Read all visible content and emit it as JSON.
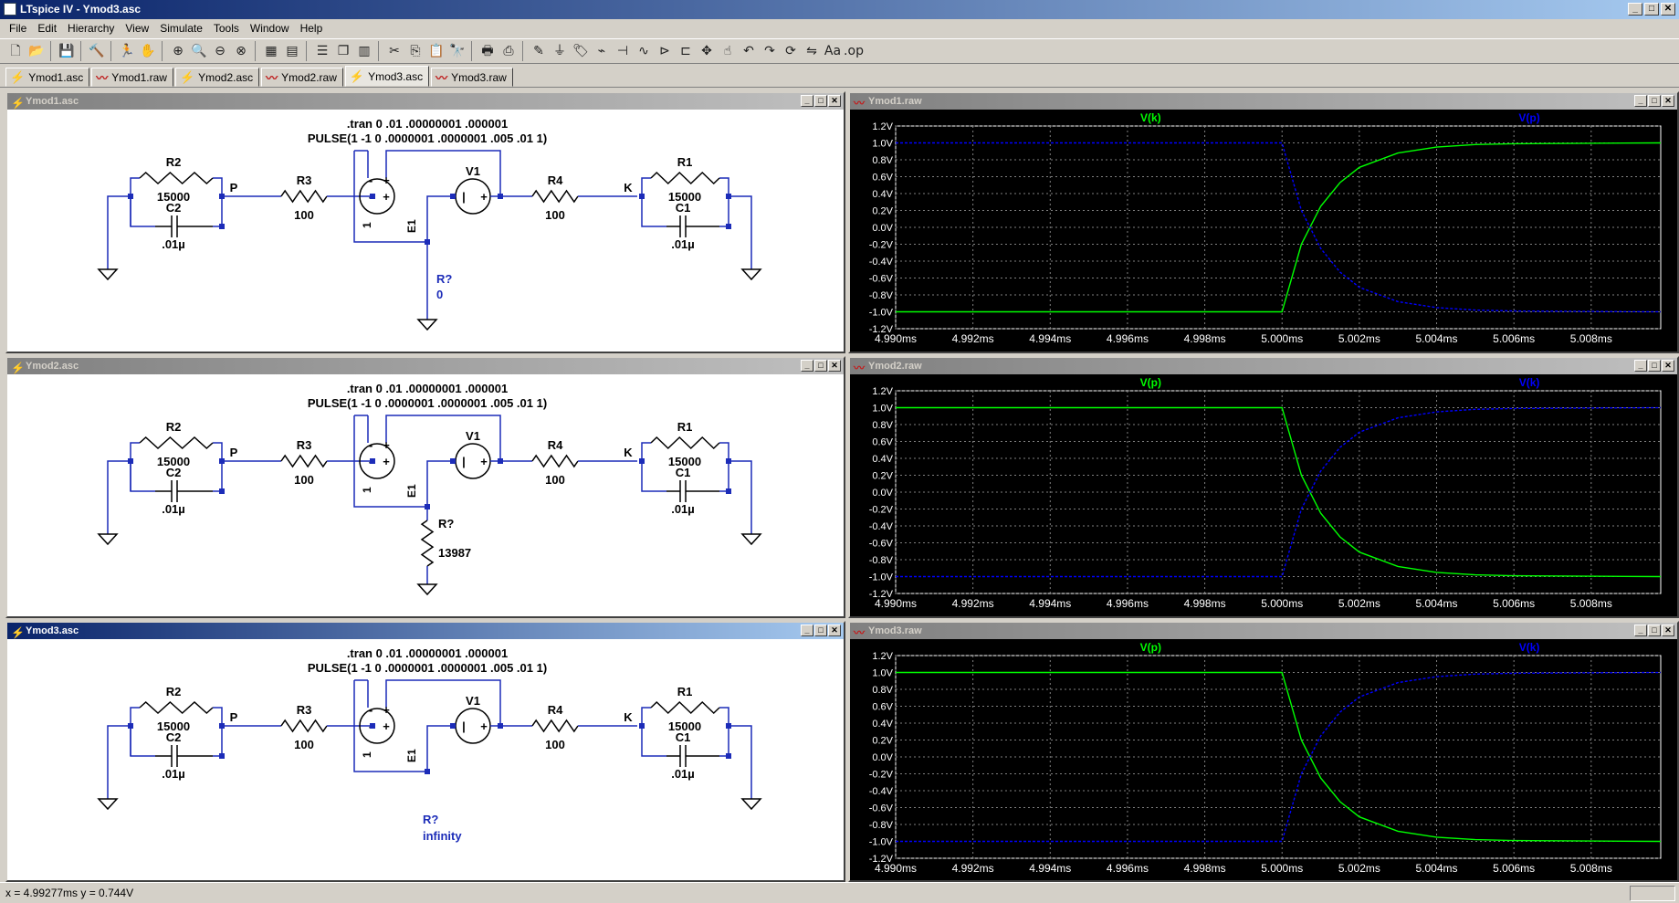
{
  "window": {
    "title": "LTspice IV - Ymod3.asc",
    "min": "_",
    "max": "□",
    "close": "✕"
  },
  "menu": [
    "File",
    "Edit",
    "Hierarchy",
    "View",
    "Simulate",
    "Tools",
    "Window",
    "Help"
  ],
  "tabs": [
    {
      "label": "Ymod1.asc",
      "icon": "schematic-icon"
    },
    {
      "label": "Ymod1.raw",
      "icon": "waveform-icon"
    },
    {
      "label": "Ymod2.asc",
      "icon": "schematic-icon"
    },
    {
      "label": "Ymod2.raw",
      "icon": "waveform-icon"
    },
    {
      "label": "Ymod3.asc",
      "icon": "schematic-icon",
      "active": true
    },
    {
      "label": "Ymod3.raw",
      "icon": "waveform-icon"
    }
  ],
  "schematics": [
    {
      "title": "Ymod1.asc",
      "active": false,
      "directive1": ".tran 0 .01 .00000001 .000001",
      "directive2": "PULSE(1 -1 0 .0000001 .0000001 .005 .01 1)",
      "r2": "R2",
      "r2val": "15000",
      "c2": "C2",
      "c2val": ".01µ",
      "node_p": "P",
      "r3": "R3",
      "r3val": "100",
      "e1": "E1",
      "e1gain": "1",
      "v1": "V1",
      "r4": "R4",
      "r4val": "100",
      "node_k": "K",
      "r1": "R1",
      "r1val": "15000",
      "c1": "C1",
      "c1val": ".01µ",
      "rq": "R?",
      "rqval": "0",
      "rq_kind": "short"
    },
    {
      "title": "Ymod2.asc",
      "active": false,
      "directive1": ".tran 0 .01 .00000001 .000001",
      "directive2": "PULSE(1 -1 0 .0000001 .0000001 .005 .01 1)",
      "r2": "R2",
      "r2val": "15000",
      "c2": "C2",
      "c2val": ".01µ",
      "node_p": "P",
      "r3": "R3",
      "r3val": "100",
      "e1": "E1",
      "e1gain": "1",
      "v1": "V1",
      "r4": "R4",
      "r4val": "100",
      "node_k": "K",
      "r1": "R1",
      "r1val": "15000",
      "c1": "C1",
      "c1val": ".01µ",
      "rq": "R?",
      "rqval": "13987",
      "rq_kind": "resistor"
    },
    {
      "title": "Ymod3.asc",
      "active": true,
      "directive1": ".tran 0 .01 .00000001 .000001",
      "directive2": "PULSE(1 -1 0 .0000001 .0000001 .005 .01 1)",
      "r2": "R2",
      "r2val": "15000",
      "c2": "C2",
      "c2val": ".01µ",
      "node_p": "P",
      "r3": "R3",
      "r3val": "100",
      "e1": "E1",
      "e1gain": "1",
      "v1": "V1",
      "r4": "R4",
      "r4val": "100",
      "node_k": "K",
      "r1": "R1",
      "r1val": "15000",
      "c1": "C1",
      "c1val": ".01µ",
      "rq": "R?",
      "rqval": "infinity",
      "rq_kind": "open"
    }
  ],
  "chart_data": [
    {
      "type": "line",
      "title": "Ymod1.raw",
      "xlim": [
        4.99,
        5.0098
      ],
      "ylim": [
        -1.2,
        1.2
      ],
      "xticks": [
        "4.990ms",
        "4.992ms",
        "4.994ms",
        "4.996ms",
        "4.998ms",
        "5.000ms",
        "5.002ms",
        "5.004ms",
        "5.006ms",
        "5.008ms"
      ],
      "xtick_values": [
        4.99,
        4.992,
        4.994,
        4.996,
        4.998,
        5.0,
        5.002,
        5.004,
        5.006,
        5.008
      ],
      "yticks": [
        "1.2V",
        "1.0V",
        "0.8V",
        "0.6V",
        "0.4V",
        "0.2V",
        "0.0V",
        "-0.2V",
        "-0.4V",
        "-0.6V",
        "-0.8V",
        "-1.0V",
        "-1.2V"
      ],
      "ytick_values": [
        1.2,
        1.0,
        0.8,
        0.6,
        0.4,
        0.2,
        0.0,
        -0.2,
        -0.4,
        -0.6,
        -0.8,
        -1.0,
        -1.2
      ],
      "grid": true,
      "series": [
        {
          "name": "V(k)",
          "color": "#00ff00",
          "x": [
            4.99,
            5.0,
            5.0005,
            5.001,
            5.0015,
            5.002,
            5.003,
            5.004,
            5.005,
            5.006,
            5.0098
          ],
          "y": [
            -1.0,
            -1.0,
            -0.2,
            0.25,
            0.53,
            0.71,
            0.88,
            0.95,
            0.98,
            0.99,
            1.0
          ]
        },
        {
          "name": "V(p)",
          "color": "#0000ff",
          "x": [
            4.99,
            5.0,
            5.0005,
            5.001,
            5.0015,
            5.002,
            5.003,
            5.004,
            5.005,
            5.006,
            5.0098
          ],
          "y": [
            1.0,
            1.0,
            0.2,
            -0.25,
            -0.53,
            -0.71,
            -0.88,
            -0.95,
            -0.98,
            -0.99,
            -1.0
          ]
        }
      ]
    },
    {
      "type": "line",
      "title": "Ymod2.raw",
      "xlim": [
        4.99,
        5.0098
      ],
      "ylim": [
        -1.2,
        1.2
      ],
      "xticks": [
        "4.990ms",
        "4.992ms",
        "4.994ms",
        "4.996ms",
        "4.998ms",
        "5.000ms",
        "5.002ms",
        "5.004ms",
        "5.006ms",
        "5.008ms"
      ],
      "xtick_values": [
        4.99,
        4.992,
        4.994,
        4.996,
        4.998,
        5.0,
        5.002,
        5.004,
        5.006,
        5.008
      ],
      "yticks": [
        "1.2V",
        "1.0V",
        "0.8V",
        "0.6V",
        "0.4V",
        "0.2V",
        "0.0V",
        "-0.2V",
        "-0.4V",
        "-0.6V",
        "-0.8V",
        "-1.0V",
        "-1.2V"
      ],
      "ytick_values": [
        1.2,
        1.0,
        0.8,
        0.6,
        0.4,
        0.2,
        0.0,
        -0.2,
        -0.4,
        -0.6,
        -0.8,
        -1.0,
        -1.2
      ],
      "grid": true,
      "series": [
        {
          "name": "V(p)",
          "color": "#00ff00",
          "x": [
            4.99,
            5.0,
            5.0005,
            5.001,
            5.0015,
            5.002,
            5.003,
            5.004,
            5.005,
            5.006,
            5.0098
          ],
          "y": [
            1.0,
            1.0,
            0.2,
            -0.25,
            -0.53,
            -0.71,
            -0.88,
            -0.95,
            -0.98,
            -0.99,
            -1.0
          ]
        },
        {
          "name": "V(k)",
          "color": "#0000ff",
          "x": [
            4.99,
            5.0,
            5.0005,
            5.001,
            5.0015,
            5.002,
            5.003,
            5.004,
            5.005,
            5.006,
            5.0098
          ],
          "y": [
            -1.0,
            -1.0,
            -0.2,
            0.25,
            0.53,
            0.71,
            0.88,
            0.95,
            0.98,
            0.99,
            1.0
          ]
        }
      ]
    },
    {
      "type": "line",
      "title": "Ymod3.raw",
      "xlim": [
        4.99,
        5.0098
      ],
      "ylim": [
        -1.2,
        1.2
      ],
      "xticks": [
        "4.990ms",
        "4.992ms",
        "4.994ms",
        "4.996ms",
        "4.998ms",
        "5.000ms",
        "5.002ms",
        "5.004ms",
        "5.006ms",
        "5.008ms"
      ],
      "xtick_values": [
        4.99,
        4.992,
        4.994,
        4.996,
        4.998,
        5.0,
        5.002,
        5.004,
        5.006,
        5.008
      ],
      "yticks": [
        "1.2V",
        "1.0V",
        "0.8V",
        "0.6V",
        "0.4V",
        "0.2V",
        "0.0V",
        "-0.2V",
        "-0.4V",
        "-0.6V",
        "-0.8V",
        "-1.0V",
        "-1.2V"
      ],
      "ytick_values": [
        1.2,
        1.0,
        0.8,
        0.6,
        0.4,
        0.2,
        0.0,
        -0.2,
        -0.4,
        -0.6,
        -0.8,
        -1.0,
        -1.2
      ],
      "grid": true,
      "series": [
        {
          "name": "V(p)",
          "color": "#00ff00",
          "x": [
            4.99,
            5.0,
            5.0005,
            5.001,
            5.0015,
            5.002,
            5.003,
            5.004,
            5.005,
            5.006,
            5.0098
          ],
          "y": [
            1.0,
            1.0,
            0.2,
            -0.25,
            -0.53,
            -0.71,
            -0.88,
            -0.95,
            -0.98,
            -0.99,
            -1.0
          ]
        },
        {
          "name": "V(k)",
          "color": "#0000ff",
          "x": [
            4.99,
            5.0,
            5.0005,
            5.001,
            5.0015,
            5.002,
            5.003,
            5.004,
            5.005,
            5.006,
            5.0098
          ],
          "y": [
            -1.0,
            -1.0,
            -0.2,
            0.25,
            0.53,
            0.71,
            0.88,
            0.95,
            0.98,
            0.99,
            1.0
          ]
        }
      ]
    }
  ],
  "status": {
    "cursor": "x = 4.99277ms    y = 0.744V"
  },
  "colors": {
    "wire": "#1c2cb8",
    "grid": "#808080",
    "axis": "#ffffff"
  }
}
